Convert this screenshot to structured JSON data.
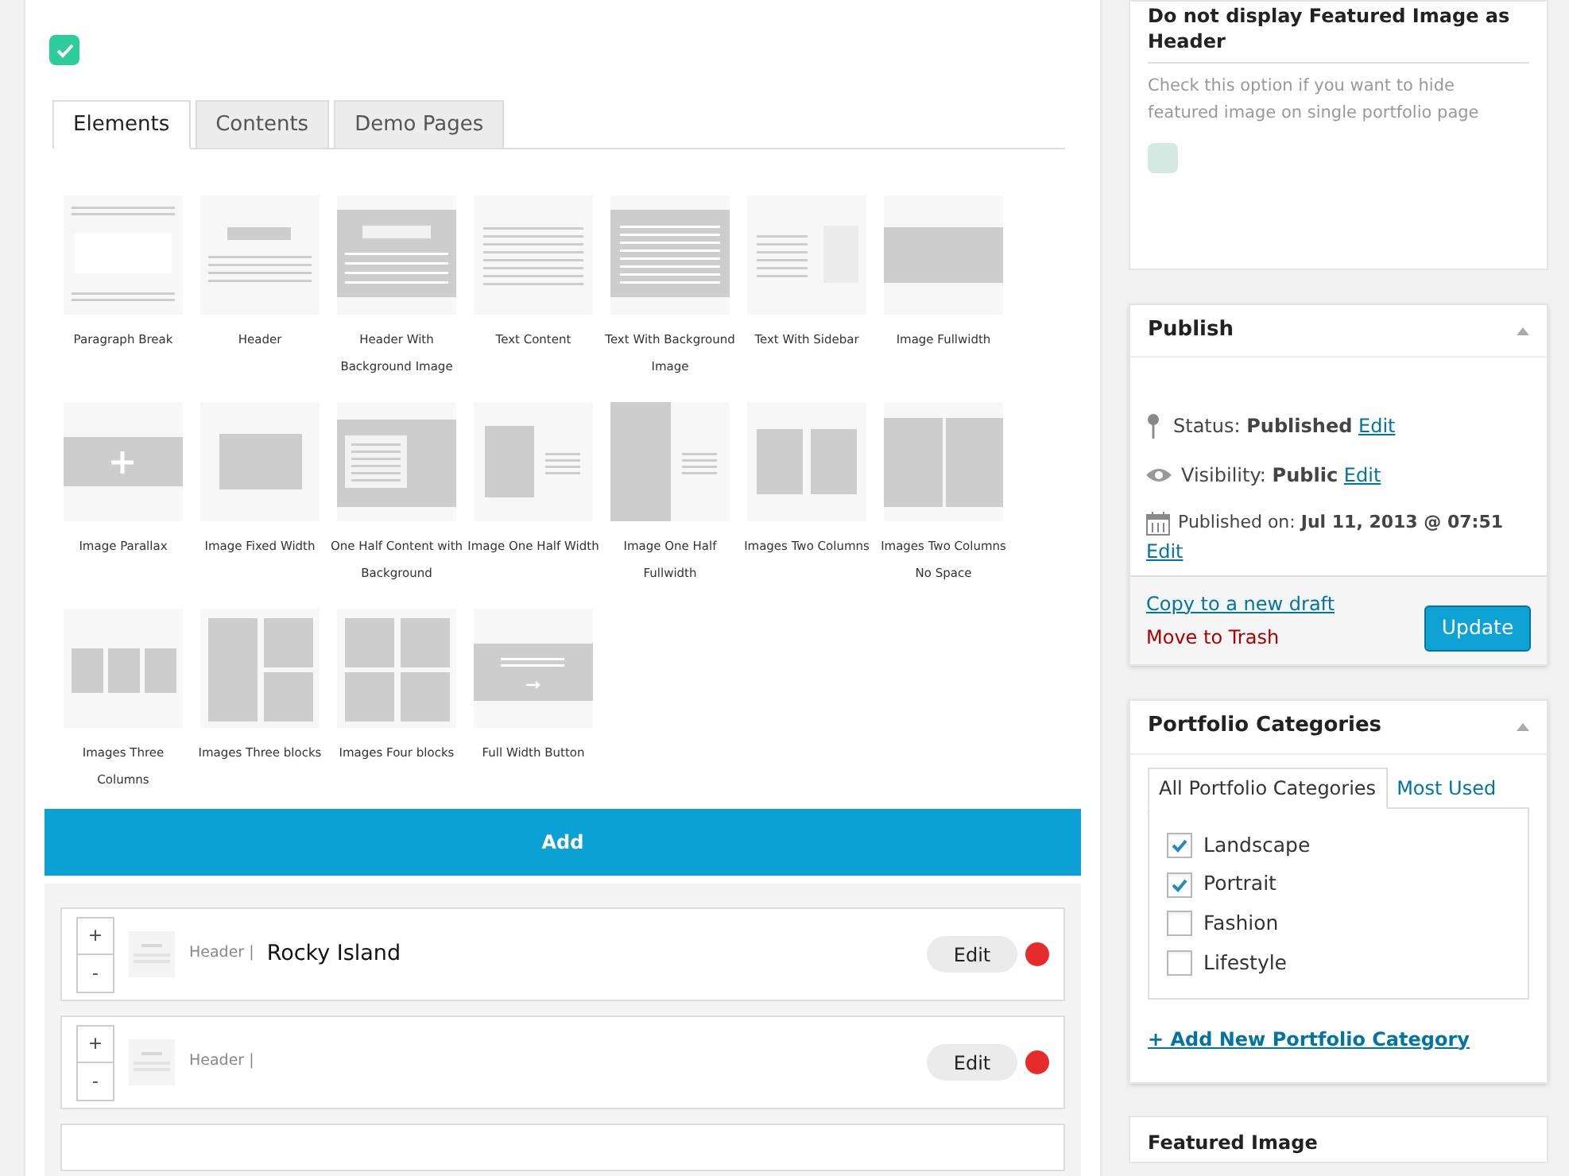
{
  "builder": {
    "enabled_checkbox": {
      "checked": true
    },
    "tabs": [
      {
        "label": "Elements",
        "selected": true
      },
      {
        "label": "Contents",
        "selected": false
      },
      {
        "label": "Demo Pages",
        "selected": false
      }
    ],
    "elements": [
      {
        "label": "Paragraph Break",
        "kind": "paragraph"
      },
      {
        "label": "Header",
        "kind": "header"
      },
      {
        "label": "Header With Background Image",
        "kind": "headerbg"
      },
      {
        "label": "Text Content",
        "kind": "text"
      },
      {
        "label": "Text With Background Image",
        "kind": "textbg"
      },
      {
        "label": "Text With Sidebar",
        "kind": "textsidebar"
      },
      {
        "label": "Image Fullwidth",
        "kind": "imagefull"
      },
      {
        "label": "Image Parallax",
        "kind": "parallax"
      },
      {
        "label": "Image Fixed Width",
        "kind": "imagefixed"
      },
      {
        "label": "One Half Content with Background",
        "kind": "halfcontent"
      },
      {
        "label": "Image One Half Width",
        "kind": "halfimage"
      },
      {
        "label": "Image One Half Fullwidth",
        "kind": "halffull"
      },
      {
        "label": "Images Two Columns",
        "kind": "twocol"
      },
      {
        "label": "Images Two Columns No Space",
        "kind": "twocolnospace"
      },
      {
        "label": "Images Three Columns",
        "kind": "threecol"
      },
      {
        "label": "Images Three blocks",
        "kind": "threeblocks"
      },
      {
        "label": "Images Four blocks",
        "kind": "fourblocks"
      },
      {
        "label": "Full Width Button",
        "kind": "button"
      }
    ],
    "add_button": "Add",
    "rows": [
      {
        "plus": "+",
        "minus": "-",
        "type": "Header |",
        "title": "Rocky Island",
        "edit": "Edit",
        "color": "#e52b2b"
      },
      {
        "plus": "+",
        "minus": "-",
        "type": "Header |",
        "edit": "Edit",
        "color": "#e52b2b"
      }
    ]
  },
  "sidebar": {
    "featured_option": {
      "title": "Do not display Featured Image as Header",
      "description": "Check this option if you want to hide featured image on single portfolio page",
      "checked": false
    },
    "publish": {
      "title": "Publish",
      "status_label": "Status:",
      "status": "Published",
      "visibility_label": "Visibility:",
      "visibility": "Public",
      "published_label": "Published on:",
      "published": "Jul 11, 2013 @ 07:51",
      "status_edit": "Edit",
      "visibility_edit": "Edit",
      "published_edit": "Edit",
      "copy_link": "Copy to a new draft",
      "trash_link": "Move to Trash",
      "update_button": "Update"
    },
    "categories": {
      "title": "Portfolio Categories",
      "tabs": [
        {
          "label": "All Portfolio Categories",
          "selected": true
        },
        {
          "label": "Most Used",
          "selected": false
        }
      ],
      "items": [
        {
          "label": "Landscape",
          "checked": true
        },
        {
          "label": "Portrait",
          "checked": true
        },
        {
          "label": "Fashion",
          "checked": false
        },
        {
          "label": "Lifestyle",
          "checked": false
        }
      ],
      "add_link": "+ Add New Portfolio Category"
    },
    "featured_image": {
      "title": "Featured Image"
    }
  }
}
